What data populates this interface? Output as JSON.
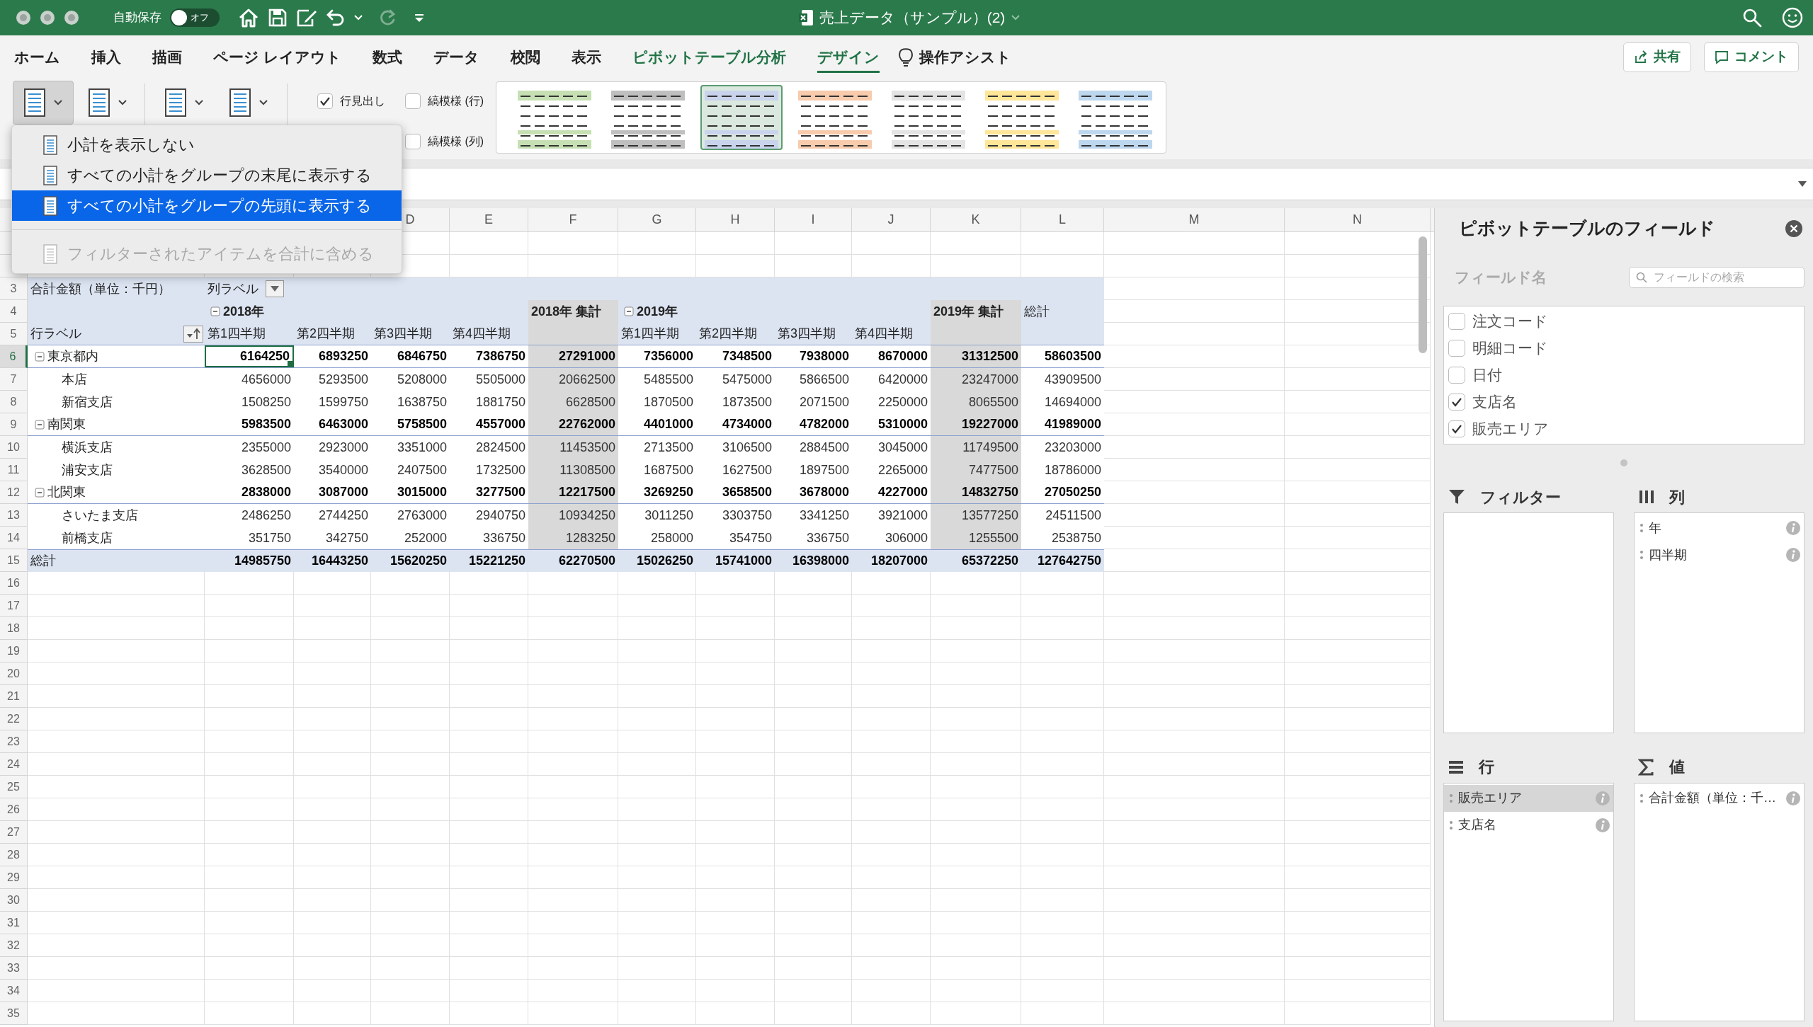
{
  "title_bar": {
    "autosave_label": "自動保存",
    "autosave": {
      "on": false,
      "label": "オフ"
    },
    "document_title": "売上データ（サンプル）(2)"
  },
  "ribbon_tabs": [
    {
      "label": "ホーム",
      "selected": false,
      "contextual": false
    },
    {
      "label": "挿入",
      "selected": false,
      "contextual": false
    },
    {
      "label": "描画",
      "selected": false,
      "contextual": false
    },
    {
      "label": "ページ レイアウト",
      "selected": false,
      "contextual": false
    },
    {
      "label": "数式",
      "selected": false,
      "contextual": false
    },
    {
      "label": "データ",
      "selected": false,
      "contextual": false
    },
    {
      "label": "校閲",
      "selected": false,
      "contextual": false
    },
    {
      "label": "表示",
      "selected": false,
      "contextual": false
    },
    {
      "label": "ピボットテーブル分析",
      "selected": false,
      "contextual": true
    },
    {
      "label": "デザイン",
      "selected": true,
      "contextual": true
    }
  ],
  "tell_me": "操作アシスト",
  "share_button": "共有",
  "comment_button": "コメント",
  "ribbon": {
    "layout_buttons": [
      {
        "selected": true
      },
      {
        "selected": false
      },
      {
        "selected": false
      },
      {
        "selected": false
      }
    ],
    "options": [
      {
        "label": "行見出し",
        "checked": true
      },
      {
        "label": "縞模様 (行)",
        "checked": false
      },
      {
        "label": "縞模様 (列)",
        "checked": false
      }
    ],
    "styles": [
      {
        "color": "#c6e0b4",
        "selected": false
      },
      {
        "color": "#bfbfbf",
        "selected": false
      },
      {
        "color": "#c9d4ec",
        "selected": true
      },
      {
        "color": "#f8cbad",
        "selected": false
      },
      {
        "color": "#e4e4e4",
        "selected": false
      },
      {
        "color": "#ffe699",
        "selected": false
      },
      {
        "color": "#bdd7ee",
        "selected": false
      }
    ]
  },
  "subtotal_menu": {
    "groups": [
      {
        "items": [
          {
            "label": "小計を表示しない",
            "selected": false,
            "disabled": false
          },
          {
            "label": "すべての小計をグループの末尾に表示する",
            "selected": false,
            "disabled": false
          },
          {
            "label": "すべての小計をグループの先頭に表示する",
            "selected": true,
            "disabled": false
          }
        ]
      },
      {
        "items": [
          {
            "label": "フィルターされたアイテムを合計に含める",
            "selected": false,
            "disabled": true
          }
        ]
      }
    ]
  },
  "sheet": {
    "column_headers": [
      "D",
      "E",
      "F",
      "G",
      "H",
      "I",
      "J",
      "K",
      "L",
      "M",
      "N"
    ],
    "row_numbers": [
      "3",
      "4",
      "5",
      "6",
      "7",
      "8",
      "9",
      "10",
      "11",
      "12",
      "13",
      "14",
      "15",
      "16",
      "17",
      "18",
      "19",
      "20",
      "21",
      "22",
      "23",
      "24",
      "25",
      "26",
      "27",
      "28",
      "29",
      "30",
      "31",
      "32",
      "33",
      "34",
      "35"
    ],
    "pivot": {
      "value_field_label": "合計金額（単位：千円）",
      "column_labels_caption": "列ラベル",
      "row_labels_caption": "行ラベル",
      "years": [
        {
          "label": "2018年",
          "expanded": true,
          "quarters": [
            "第1四半期",
            "第2四半期",
            "第3四半期",
            "第4四半期"
          ],
          "subtotal_label": "2018年 集計"
        },
        {
          "label": "2019年",
          "expanded": true,
          "quarters": [
            "第1四半期",
            "第2四半期",
            "第3四半期",
            "第4四半期"
          ],
          "subtotal_label": "2019年 集計"
        }
      ],
      "grand_total_label": "総計",
      "rows": [
        {
          "label": "東京都内",
          "expanded": true,
          "selected": true,
          "values": [
            "6164250",
            "6893250",
            "6846750",
            "7386750",
            "27291000",
            "7356000",
            "7348500",
            "7938000",
            "8670000",
            "31312500",
            "58603500"
          ],
          "children": [
            {
              "label": "本店",
              "selected": false,
              "values": [
                "4656000",
                "5293500",
                "5208000",
                "5505000",
                "20662500",
                "5485500",
                "5475000",
                "5866500",
                "6420000",
                "23247000",
                "43909500"
              ]
            },
            {
              "label": "新宿支店",
              "selected": false,
              "values": [
                "1508250",
                "1599750",
                "1638750",
                "1881750",
                "6628500",
                "1870500",
                "1873500",
                "2071500",
                "2250000",
                "8065500",
                "14694000"
              ]
            }
          ]
        },
        {
          "label": "南関東",
          "expanded": true,
          "selected": false,
          "values": [
            "5983500",
            "6463000",
            "5758500",
            "4557000",
            "22762000",
            "4401000",
            "4734000",
            "4782000",
            "5310000",
            "19227000",
            "41989000"
          ],
          "children": [
            {
              "label": "横浜支店",
              "selected": false,
              "values": [
                "2355000",
                "2923000",
                "3351000",
                "2824500",
                "11453500",
                "2713500",
                "3106500",
                "2884500",
                "3045000",
                "11749500",
                "23203000"
              ]
            },
            {
              "label": "浦安支店",
              "selected": false,
              "values": [
                "3628500",
                "3540000",
                "2407500",
                "1732500",
                "11308500",
                "1687500",
                "1627500",
                "1897500",
                "2265000",
                "7477500",
                "18786000"
              ]
            }
          ]
        },
        {
          "label": "北関東",
          "expanded": true,
          "selected": false,
          "values": [
            "2838000",
            "3087000",
            "3015000",
            "3277500",
            "12217500",
            "3269250",
            "3658500",
            "3678000",
            "4227000",
            "14832750",
            "27050250"
          ],
          "children": [
            {
              "label": "さいたま支店",
              "selected": false,
              "values": [
                "2486250",
                "2744250",
                "2763000",
                "2940750",
                "10934250",
                "3011250",
                "3303750",
                "3341250",
                "3921000",
                "13577250",
                "24511500"
              ]
            },
            {
              "label": "前橋支店",
              "selected": false,
              "values": [
                "351750",
                "342750",
                "252000",
                "336750",
                "1283250",
                "258000",
                "354750",
                "336750",
                "306000",
                "1255500",
                "2538750"
              ]
            }
          ]
        }
      ],
      "total": {
        "label": "総計",
        "selected": false,
        "values": [
          "14985750",
          "16443250",
          "15620250",
          "15221250",
          "62270500",
          "15026250",
          "15741000",
          "16398000",
          "18207000",
          "65372250",
          "127642750"
        ]
      }
    }
  },
  "field_list": {
    "title": "ピボットテーブルのフィールド",
    "field_name_label": "フィールド名",
    "search": {
      "placeholder": "フィールドの検索"
    },
    "fields": [
      {
        "label": "注文コード",
        "checked": false
      },
      {
        "label": "明細コード",
        "checked": false
      },
      {
        "label": "日付",
        "checked": false
      },
      {
        "label": "支店名",
        "checked": true
      },
      {
        "label": "販売エリア",
        "checked": true
      }
    ],
    "areas": [
      {
        "kind": "filter",
        "label": "フィルター"
      },
      {
        "kind": "columns",
        "label": "列",
        "items": [
          {
            "label": "年",
            "selected": false
          },
          {
            "label": "四半期",
            "selected": false
          }
        ]
      },
      {
        "kind": "rows",
        "label": "行",
        "items": [
          {
            "label": "販売エリア",
            "selected": true
          },
          {
            "label": "支店名",
            "selected": false
          }
        ]
      },
      {
        "kind": "values",
        "label": "値",
        "items": [
          {
            "label": "合計金額（単位：千…",
            "selected": false
          }
        ]
      }
    ]
  }
}
